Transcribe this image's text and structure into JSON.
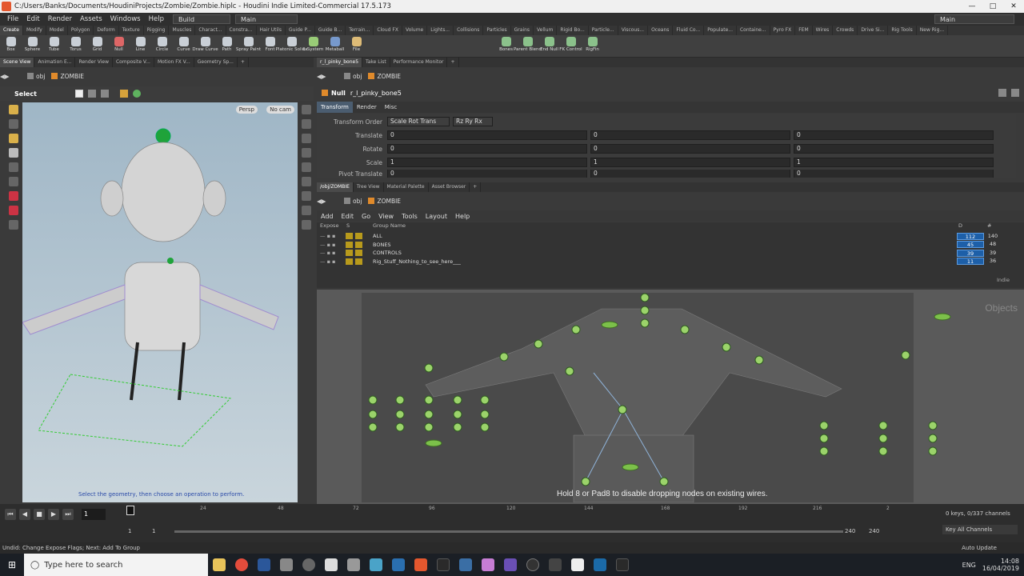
{
  "window": {
    "title": "C:/Users/Banks/Documents/HoudiniProjects/Zombie/Zombie.hiplc - Houdini Indie Limited-Commercial 17.5.173"
  },
  "menu": {
    "items": [
      "File",
      "Edit",
      "Render",
      "Assets",
      "Windows",
      "Help"
    ],
    "build_desktop": "Build",
    "main_desktop": "Main",
    "right_desktop": "Main"
  },
  "shelf_tabs": [
    "Create",
    "Modify",
    "Model",
    "Polygon",
    "Deform",
    "Texture",
    "Rigging",
    "Muscles",
    "Charact...",
    "Constra...",
    "Hair Utils",
    "Guide P...",
    "Guide B...",
    "Terrain...",
    "Cloud FX",
    "Volume",
    "Lights...",
    "Collisions",
    "Particles",
    "Grains",
    "Vellum",
    "Rigid Bo...",
    "Particle...",
    "Viscous...",
    "Oceans",
    "Fluid Co...",
    "Populate...",
    "Containe...",
    "Pyro FX",
    "FEM",
    "Wires",
    "Crowds",
    "Drive Si...",
    "Rig Tools",
    "New Rig..."
  ],
  "shelf_tools": [
    "Box",
    "Sphere",
    "Tube",
    "Torus",
    "Grid",
    "Null",
    "Line",
    "Circle",
    "Curve",
    "Draw Curve",
    "Path",
    "Spray Paint",
    "Font",
    "Platonic Solids",
    "L-System",
    "Metaball",
    "File"
  ],
  "rig_tools": [
    "Bones",
    "Parent Blend",
    "End Null",
    "FK Control",
    "RigFin"
  ],
  "left_tabs": [
    "Scene View",
    "Animation E...",
    "Render View",
    "Composite V...",
    "Motion FX V...",
    "Geometry Sp..."
  ],
  "left_path": {
    "root": "obj",
    "node": "ZOMBIE"
  },
  "viewport": {
    "tool": "Select",
    "persp": "Persp",
    "cam": "No cam",
    "hint": "Select the geometry, then choose an operation to perform."
  },
  "param_tabs": [
    "r_l_pinky_bone5",
    "Take List",
    "Performance Monitor"
  ],
  "param_path": {
    "root": "obj",
    "node": "ZOMBIE"
  },
  "node": {
    "type": "Null",
    "name": "r_l_pinky_bone5"
  },
  "param_subtabs": [
    "Transform",
    "Render",
    "Misc"
  ],
  "params": {
    "transform_order_label": "Transform Order",
    "transform_order": "Scale Rot Trans",
    "rot_order": "Rz Ry Rx",
    "translate_label": "Translate",
    "translate": [
      "0",
      "0",
      "0"
    ],
    "rotate_label": "Rotate",
    "rotate": [
      "0",
      "0",
      "0"
    ],
    "scale_label": "Scale",
    "scale": [
      "1",
      "1",
      "1"
    ],
    "pivot_label": "Pivot Translate",
    "pivot": [
      "0",
      "0",
      "0"
    ]
  },
  "group_tabs": [
    "/obj/ZOMBIE",
    "Tree View",
    "Material Palette",
    "Asset Browser"
  ],
  "group_path": {
    "root": "obj",
    "node": "ZOMBIE"
  },
  "group_menu": [
    "Add",
    "Edit",
    "Go",
    "View",
    "Tools",
    "Layout",
    "Help"
  ],
  "group_table": {
    "headers": {
      "expose": "Expose",
      "s": "S",
      "name": "Group Name",
      "d": "D",
      "hash": "#"
    },
    "rows": [
      {
        "name": "ALL",
        "d": "112",
        "n": "140"
      },
      {
        "name": "BONES",
        "d": "45",
        "n": "48"
      },
      {
        "name": "CONTROLS",
        "d": "39",
        "n": "39"
      },
      {
        "name": "Rig_Stuff_Nothing_to_see_here___",
        "d": "11",
        "n": "36"
      }
    ],
    "footer": "Indie"
  },
  "network": {
    "hint": "Hold 8 or Pad8 to disable dropping nodes on existing wires.",
    "context_label": "Objects"
  },
  "timeline": {
    "ticks": [
      "1",
      "24",
      "48",
      "72",
      "96",
      "120",
      "144",
      "168",
      "192",
      "216",
      "2"
    ],
    "current_frame": "1",
    "start": "1",
    "start2": "1",
    "end": "240",
    "end2": "240",
    "keys_info": "0 keys, 0/337 channels",
    "channels_btn": "Key All Channels",
    "auto_update": "Auto Update"
  },
  "status": "Undid: Change Expose Flags; Next: Add To Group",
  "taskbar": {
    "search_placeholder": "Type here to search",
    "lang": "ENG",
    "time": "14:08",
    "date": "16/04/2019"
  },
  "colors": {
    "accent_orange": "#e08a2b",
    "selection_blue": "#1d5fa8",
    "node_green": "#9bd36a"
  }
}
